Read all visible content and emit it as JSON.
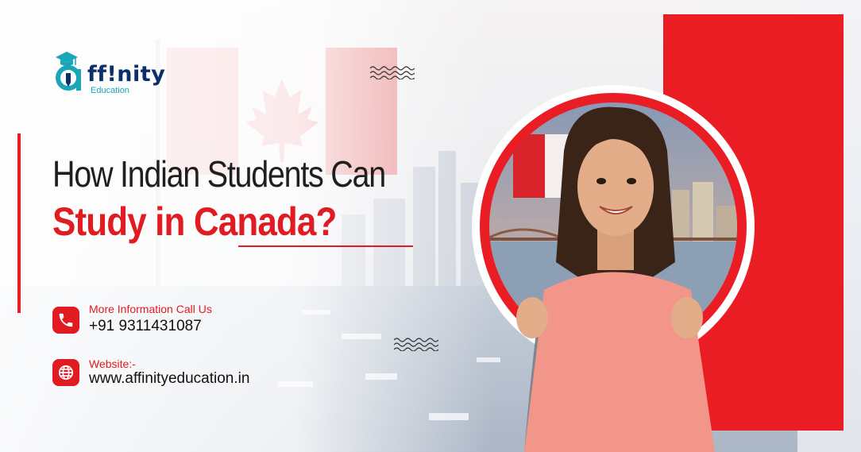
{
  "logo": {
    "word": "ff!nity",
    "sub": "Education",
    "icon": "graduation-cap-icon"
  },
  "headline": {
    "line1": "How Indian Students Can",
    "line2": "Study in Canada?"
  },
  "contact": {
    "phone_label": "More Information Call Us",
    "phone": "+91 9311431087",
    "phone_icon": "phone-icon",
    "website_label": "Website:-",
    "website": "www.affinityeducation.in",
    "website_icon": "globe-icon"
  },
  "colors": {
    "brand_red": "#ea1c24",
    "navy": "#0b2f6b",
    "teal": "#1ba6b8"
  }
}
